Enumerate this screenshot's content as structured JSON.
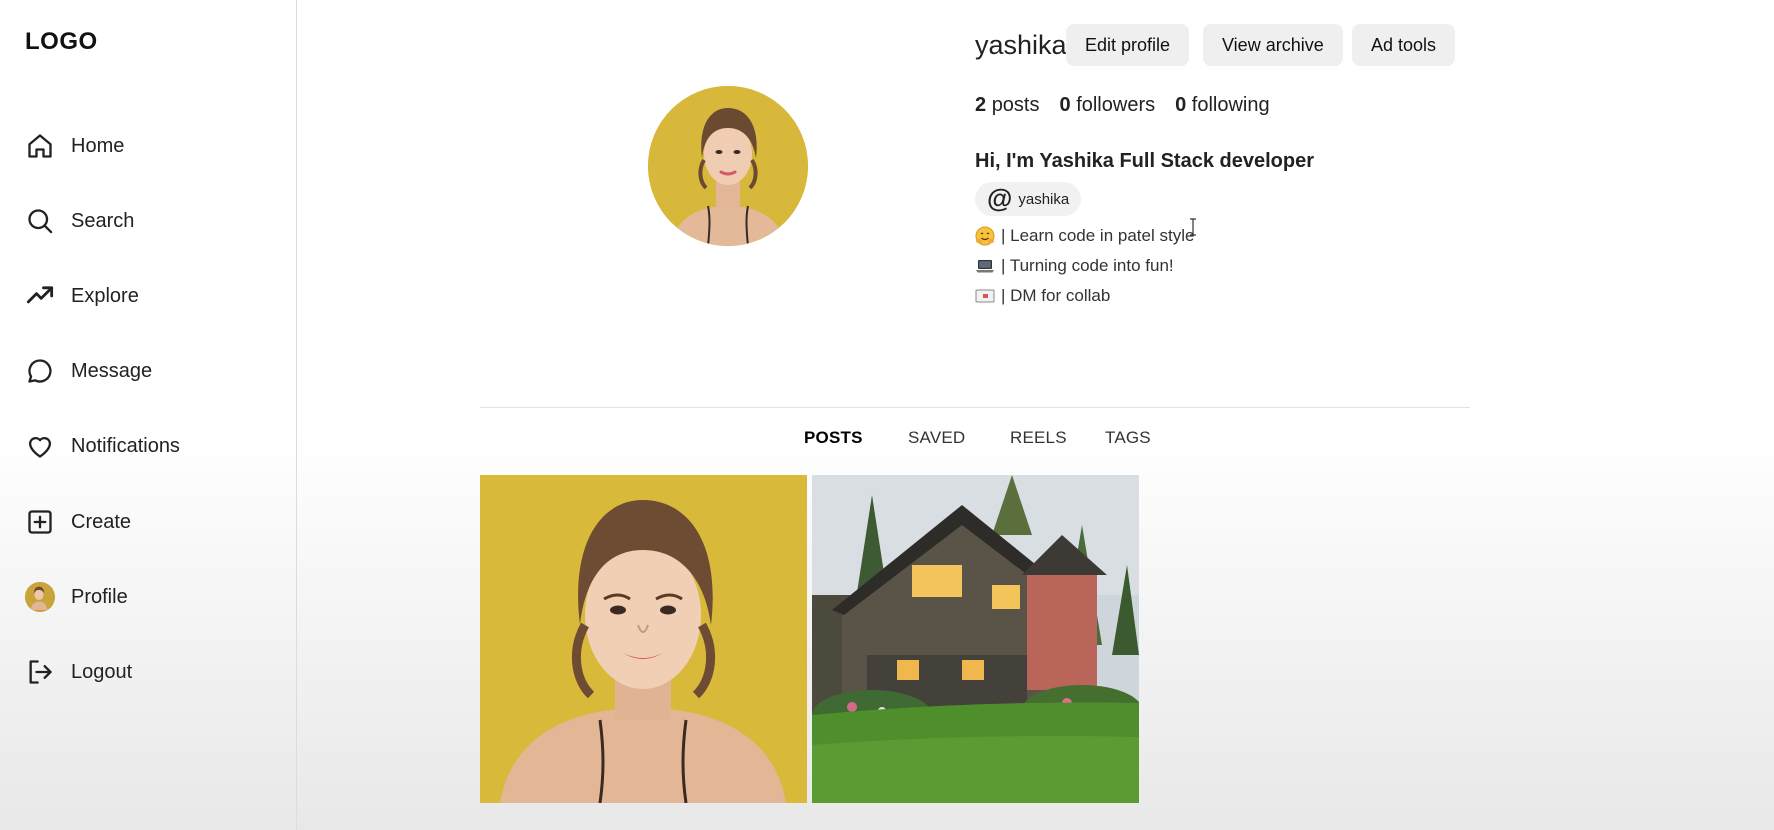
{
  "sidebar": {
    "logo": "LOGO",
    "items": [
      {
        "label": "Home",
        "icon": "home-icon"
      },
      {
        "label": "Search",
        "icon": "search-icon"
      },
      {
        "label": "Explore",
        "icon": "trending-icon"
      },
      {
        "label": "Message",
        "icon": "message-icon"
      },
      {
        "label": "Notifications",
        "icon": "heart-icon"
      },
      {
        "label": "Create",
        "icon": "plus-square-icon"
      },
      {
        "label": "Profile",
        "icon": "avatar"
      },
      {
        "label": "Logout",
        "icon": "logout-icon"
      }
    ]
  },
  "profile": {
    "username": "yashika",
    "buttons": {
      "edit": "Edit profile",
      "archive": "View archive",
      "ad_tools": "Ad tools"
    },
    "stats": {
      "posts_count": "2",
      "posts_label": "posts",
      "followers_count": "0",
      "followers_label": "followers",
      "following_count": "0",
      "following_label": "following"
    },
    "bio_title": "Hi, I'm Yashika Full Stack developer",
    "handle": "yashika",
    "bio_lines": [
      {
        "emoji": "hugging-face-icon",
        "text": "| Learn code in patel style"
      },
      {
        "emoji": "laptop-icon",
        "text": "| Turning code into fun!"
      },
      {
        "emoji": "mail-icon",
        "text": "| DM for collab"
      }
    ]
  },
  "tabs": {
    "posts": "POSTS",
    "saved": "SAVED",
    "reels": "REELS",
    "tags": "TAGS",
    "active": "POSTS"
  },
  "colors": {
    "accent_bg": "#efefef",
    "post1_bg": "#d9b93a",
    "post2_lawn": "#4a8a2a"
  }
}
